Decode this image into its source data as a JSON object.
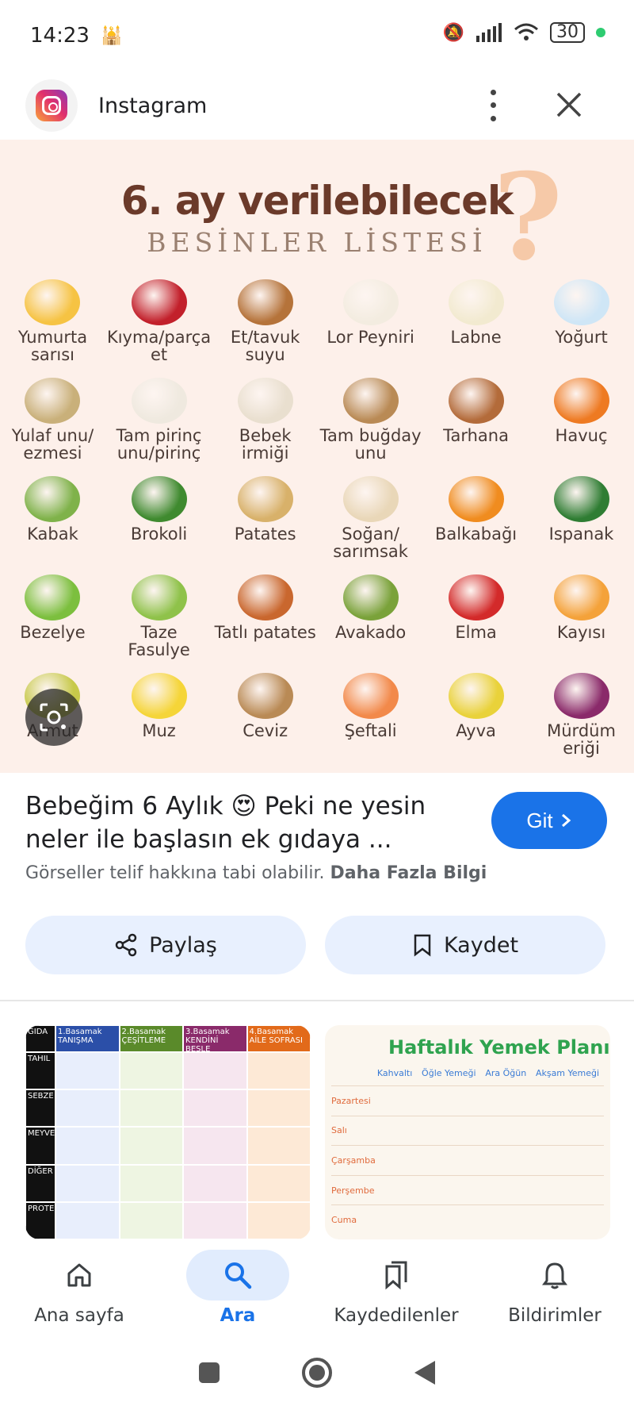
{
  "status_bar": {
    "time": "14:23",
    "battery": "30"
  },
  "header": {
    "app_name": "Instagram"
  },
  "image": {
    "title": "6. ay verilebilecek",
    "subtitle": "BESİNLER LİSTESİ",
    "foods": [
      {
        "name": "Yumurta sarısı",
        "color": "#f6c343"
      },
      {
        "name": "Kıyma/parça et",
        "color": "#c2202b"
      },
      {
        "name": "Et/tavuk suyu",
        "color": "#b5733a"
      },
      {
        "name": "Lor Peyniri",
        "color": "#f3ece0"
      },
      {
        "name": "Labne",
        "color": "#f2ead0"
      },
      {
        "name": "Yoğurt",
        "color": "#cfe6f6"
      },
      {
        "name": "Yulaf unu/ ezmesi",
        "color": "#c9b07a"
      },
      {
        "name": "Tam pirinç unu/pirinç",
        "color": "#efe9df"
      },
      {
        "name": "Bebek irmiği",
        "color": "#e9dfcf"
      },
      {
        "name": "Tam buğday unu",
        "color": "#b98a55"
      },
      {
        "name": "Tarhana",
        "color": "#b36b3a"
      },
      {
        "name": "Havuç",
        "color": "#ee7a22"
      },
      {
        "name": "Kabak",
        "color": "#7fb24a"
      },
      {
        "name": "Brokoli",
        "color": "#3f8a2f"
      },
      {
        "name": "Patates",
        "color": "#d8b16a"
      },
      {
        "name": "Soğan/ sarımsak",
        "color": "#e9d7b8"
      },
      {
        "name": "Balkabağı",
        "color": "#f08c1f"
      },
      {
        "name": "Ispanak",
        "color": "#2f7d33"
      },
      {
        "name": "Bezelye",
        "color": "#7cbf3e"
      },
      {
        "name": "Taze Fasulye",
        "color": "#8fc24a"
      },
      {
        "name": "Tatlı patates",
        "color": "#c9672e"
      },
      {
        "name": "Avakado",
        "color": "#7aa23a"
      },
      {
        "name": "Elma",
        "color": "#d32a2a"
      },
      {
        "name": "Kayısı",
        "color": "#f4a23a"
      },
      {
        "name": "Armut",
        "color": "#c7c94a"
      },
      {
        "name": "Muz",
        "color": "#f5d538"
      },
      {
        "name": "Ceviz",
        "color": "#b98a55"
      },
      {
        "name": "Şeftali",
        "color": "#f2894a"
      },
      {
        "name": "Ayva",
        "color": "#e9d23a"
      },
      {
        "name": "Mürdüm eriği",
        "color": "#8a2a6a"
      }
    ]
  },
  "result": {
    "title": "Bebeğim 6 Aylık 😍 Peki ne yesin neler ile başlasın ek gıdaya ...",
    "go_label": "Git",
    "copyright_text": "Görseller telif hakkına tabi olabilir.",
    "more_info": "Daha Fazla Bilgi"
  },
  "actions": {
    "share": "Paylaş",
    "save": "Kaydet"
  },
  "related": {
    "left": {
      "col_header": "GIDA",
      "stages": [
        "1.Basamak TANIŞMA",
        "2.Basamak ÇEŞİTLEME",
        "3.Basamak KENDİNİ BESLE",
        "4.Basamak AİLE SOFRASI"
      ],
      "rows": [
        "TAHIL",
        "SEBZE",
        "MEYVE",
        "DİĞER",
        "PROTEİN"
      ]
    },
    "right": {
      "title": "Haftalık Yemek Planı",
      "columns": [
        "Kahvaltı",
        "Öğle Yemeği",
        "Ara Öğün",
        "Akşam Yemeği"
      ],
      "rows": [
        "Pazartesi",
        "Salı",
        "Çarşamba",
        "Perşembe",
        "Cuma"
      ]
    }
  },
  "bottom_nav": [
    {
      "label": "Ana sayfa",
      "icon": "home-icon"
    },
    {
      "label": "Ara",
      "icon": "search-icon"
    },
    {
      "label": "Kaydedilenler",
      "icon": "saved-icon"
    },
    {
      "label": "Bildirimler",
      "icon": "bell-icon"
    }
  ]
}
